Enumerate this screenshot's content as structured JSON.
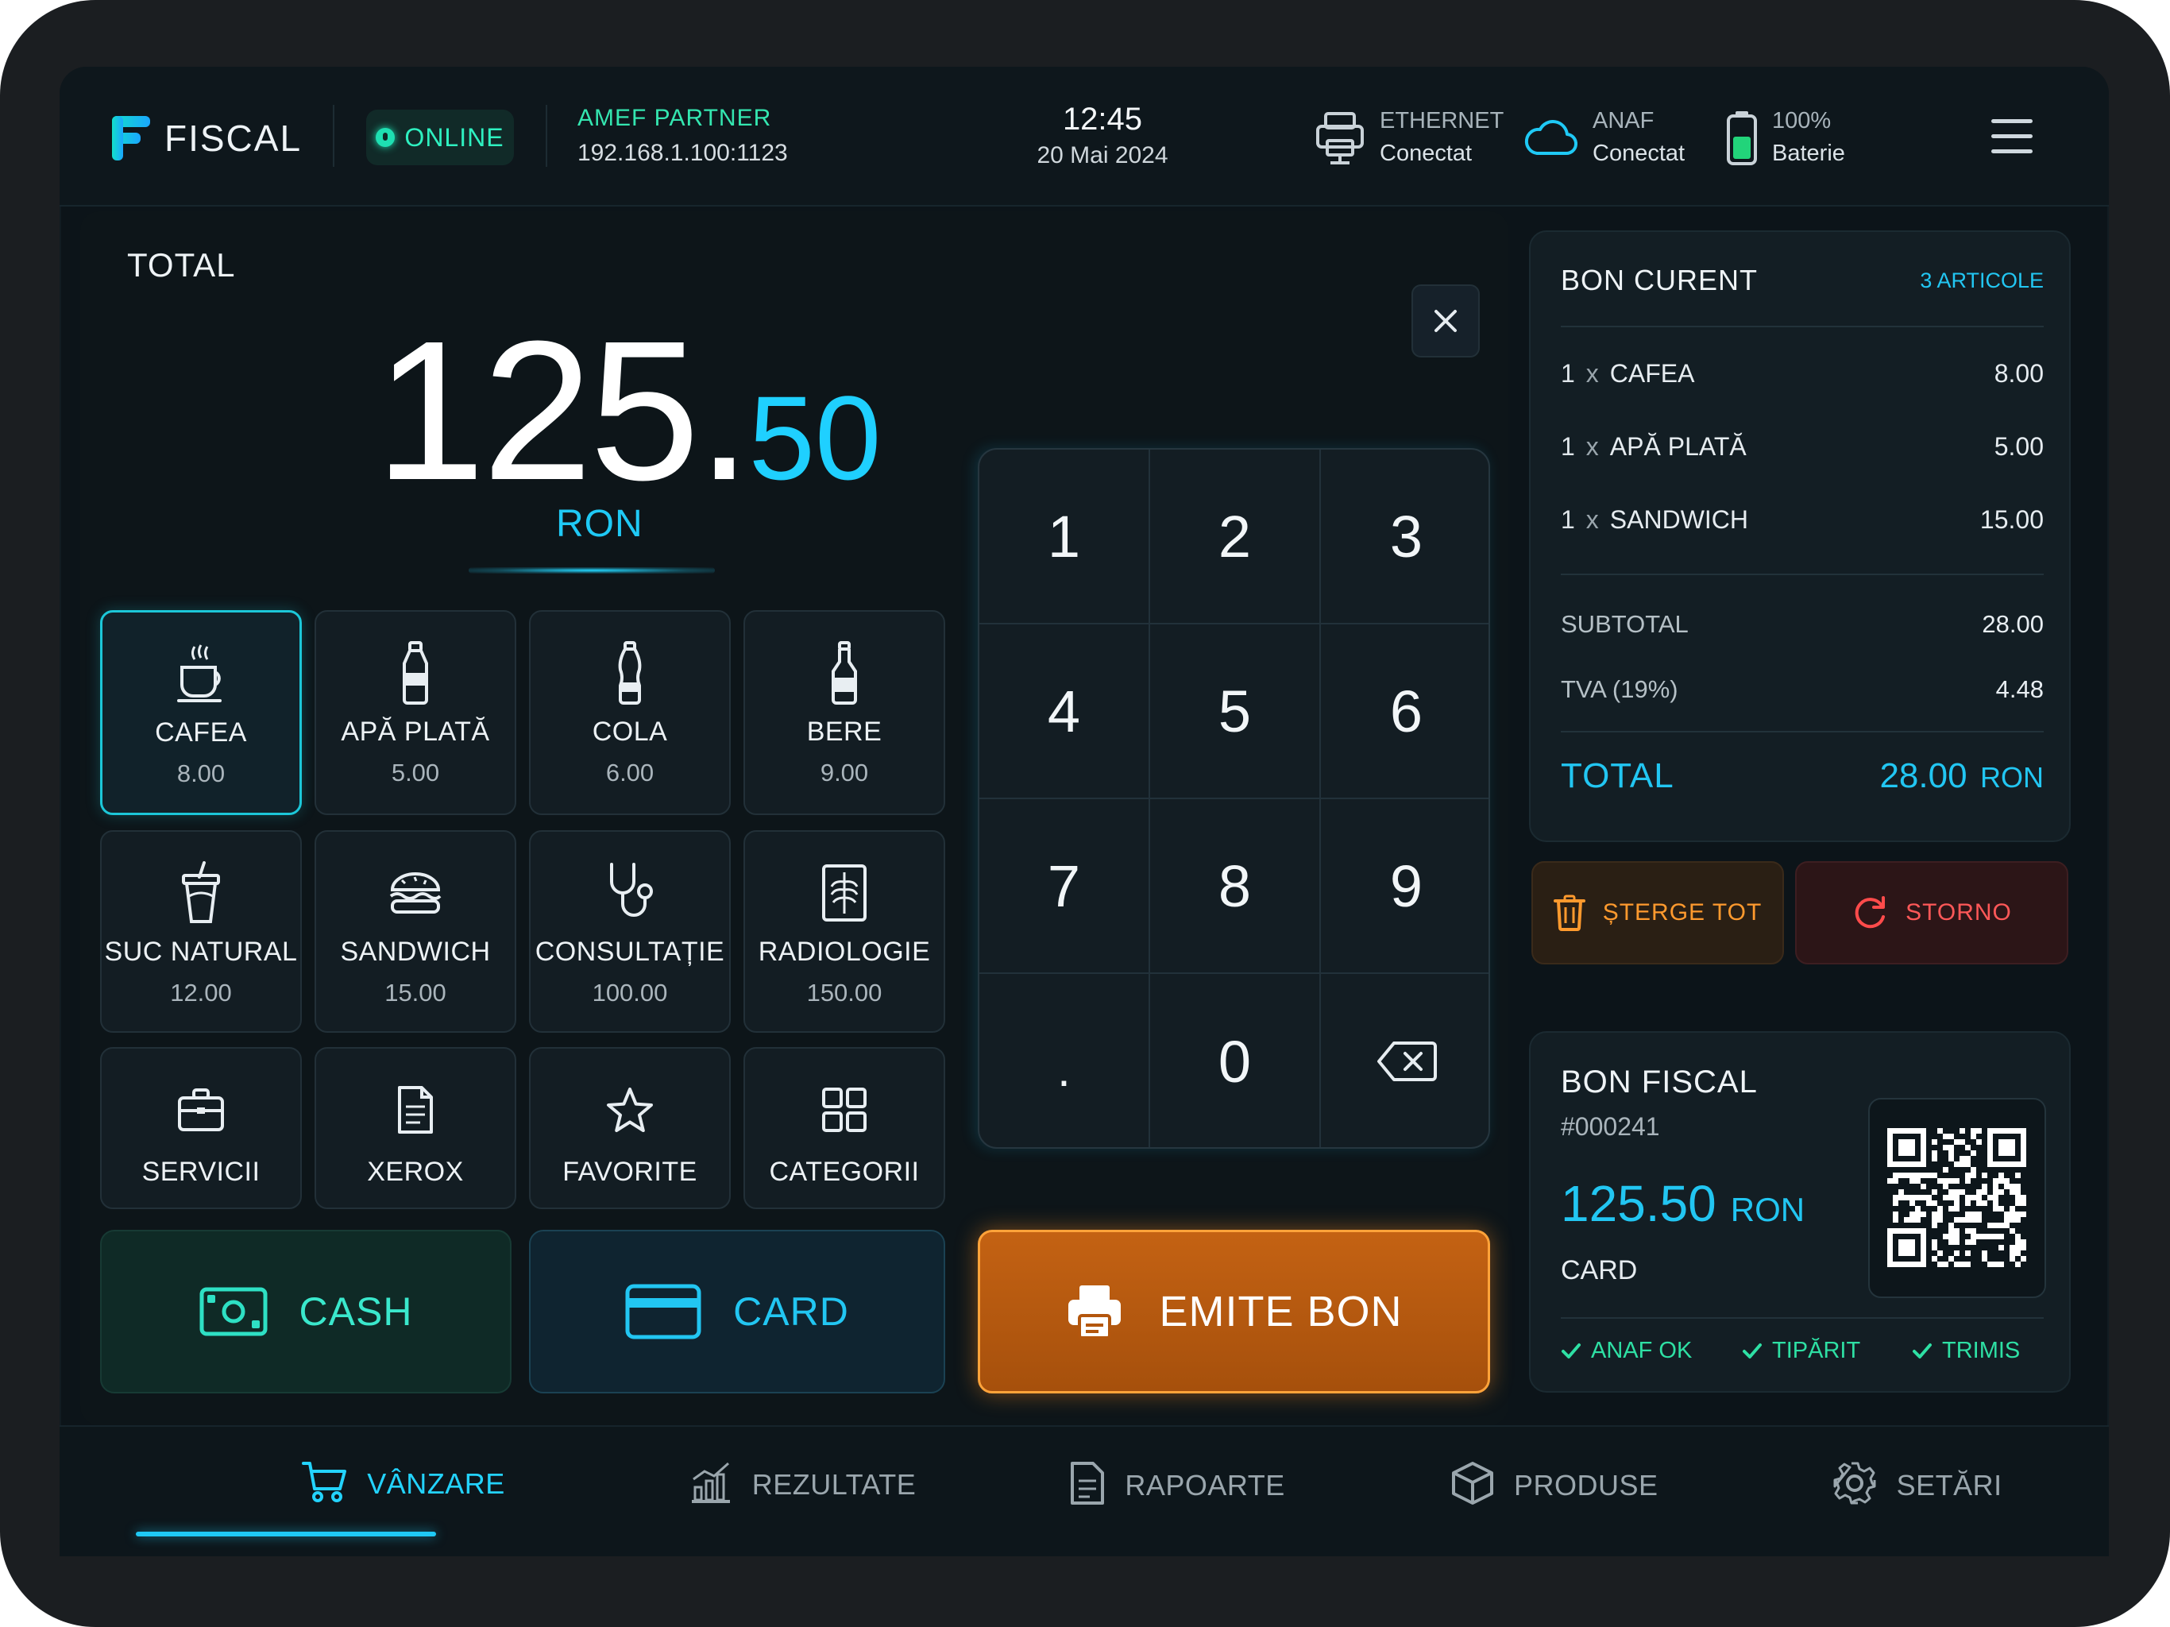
{
  "header": {
    "app_name": "FISCAL",
    "online_label": "ONLINE",
    "amef_name": "AMEF PARTNER",
    "amef_ip": "192.168.1.100:1123",
    "time": "12:45",
    "date": "20 Mai 2024",
    "ethernet": {
      "label": "ETHERNET",
      "value": "Conectat",
      "icon": "printer-network-icon"
    },
    "anaf": {
      "label": "ANAF",
      "value": "Conectat",
      "icon": "cloud-icon"
    },
    "battery": {
      "label": "100%",
      "value": "Baterie",
      "icon": "battery-icon",
      "level": 1.0
    }
  },
  "total": {
    "label": "TOTAL",
    "integer": "125.",
    "decimals": "50",
    "currency": "RON"
  },
  "products": [
    {
      "name": "CAFEA",
      "price": "8.00",
      "icon": "coffee-cup-icon",
      "selected": true
    },
    {
      "name": "APĂ PLATĂ",
      "price": "5.00",
      "icon": "water-bottle-icon"
    },
    {
      "name": "COLA",
      "price": "6.00",
      "icon": "cola-bottle-icon"
    },
    {
      "name": "BERE",
      "price": "9.00",
      "icon": "beer-bottle-icon"
    },
    {
      "name": "SUC NATURAL",
      "price": "12.00",
      "icon": "juice-cup-icon"
    },
    {
      "name": "SANDWICH",
      "price": "15.00",
      "icon": "sandwich-icon"
    },
    {
      "name": "CONSULTAȚIE",
      "price": "100.00",
      "icon": "stethoscope-icon"
    },
    {
      "name": "RADIOLOGIE",
      "price": "150.00",
      "icon": "xray-icon"
    },
    {
      "name": "SERVICII",
      "icon": "briefcase-icon"
    },
    {
      "name": "XEROX",
      "icon": "document-icon"
    },
    {
      "name": "FAVORITE",
      "icon": "star-icon"
    },
    {
      "name": "CATEGORII",
      "icon": "grid-icon"
    }
  ],
  "keypad": [
    "1",
    "2",
    "3",
    "4",
    "5",
    "6",
    "7",
    "8",
    "9",
    ".",
    "0"
  ],
  "payment": {
    "cash_label": "CASH",
    "card_label": "CARD",
    "emit_label": "EMITE BON"
  },
  "receipt": {
    "title": "BON CURENT",
    "count": "3 ARTICOLE",
    "items": [
      {
        "qty": "1",
        "x": "x",
        "name": "CAFEA",
        "amount": "8.00"
      },
      {
        "qty": "1",
        "x": "x",
        "name": "APĂ PLATĂ",
        "amount": "5.00"
      },
      {
        "qty": "1",
        "x": "x",
        "name": "SANDWICH",
        "amount": "15.00"
      }
    ],
    "subtotal_label": "SUBTOTAL",
    "subtotal": "28.00",
    "vat_label": "TVA (19%)",
    "vat": "4.48",
    "total_label": "TOTAL",
    "total": "28.00",
    "currency": "RON"
  },
  "actions": {
    "delete_label": "ȘTERGE TOT",
    "storno_label": "STORNO"
  },
  "fiscal": {
    "title": "BON FISCAL",
    "number": "#000241",
    "amount": "125.50",
    "currency": "RON",
    "method": "CARD",
    "status": [
      "ANAF OK",
      "TIPĂRIT",
      "TRIMIS"
    ]
  },
  "nav": [
    {
      "label": "VÂNZARE",
      "icon": "cart-icon",
      "active": true
    },
    {
      "label": "REZULTATE",
      "icon": "chart-icon"
    },
    {
      "label": "RAPOARTE",
      "icon": "report-icon"
    },
    {
      "label": "PRODUSE",
      "icon": "box-icon"
    },
    {
      "label": "SETĂRI",
      "icon": "gear-icon"
    }
  ],
  "colors": {
    "accent": "#1fc9f5",
    "success": "#2ee0a4",
    "emit": "#c46213",
    "storno": "#ff4b4b",
    "delete": "#ff9a2e"
  }
}
